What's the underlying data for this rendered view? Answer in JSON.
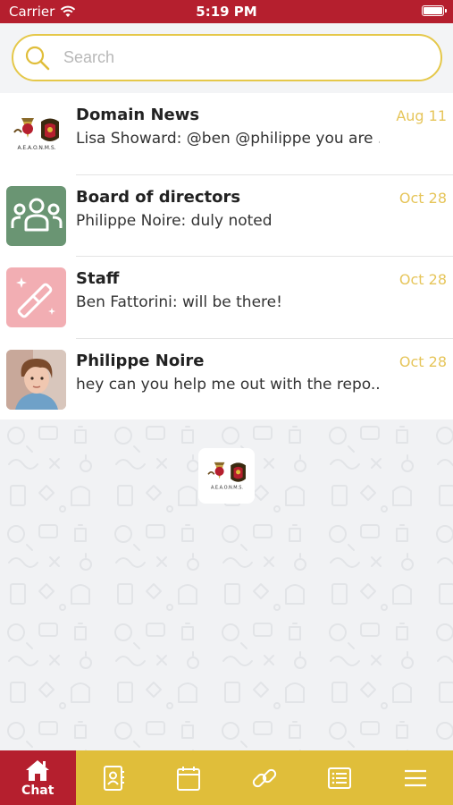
{
  "status_bar": {
    "carrier": "Carrier",
    "time": "5:19 PM"
  },
  "search": {
    "placeholder": "Search",
    "value": ""
  },
  "chats": [
    {
      "title": "Domain News",
      "preview": "Lisa Showard: @ben @philippe you are ...",
      "date": "Aug 11",
      "avatar": "organization-logo"
    },
    {
      "title": "Board of directors",
      "preview": "Philippe Noire: duly noted",
      "date": "Oct 28",
      "avatar": "group-icon",
      "avatar_color": "#6a9573"
    },
    {
      "title": "Staff",
      "preview": "Ben Fattorini: will be there!",
      "date": "Oct 28",
      "avatar": "magic-wand-icon",
      "avatar_color": "#f2aeb3"
    },
    {
      "title": "Philippe Noire",
      "preview": "hey can you help me out with the repo...",
      "date": "Oct 28",
      "avatar": "person-photo"
    }
  ],
  "logo": {
    "caption": "A.E.A.O.N.M.S."
  },
  "tab_bar": {
    "tabs": [
      {
        "label": "Chat",
        "icon": "home-icon",
        "active": true
      },
      {
        "icon": "contacts-icon"
      },
      {
        "icon": "calendar-icon"
      },
      {
        "icon": "link-icon"
      },
      {
        "icon": "list-icon"
      },
      {
        "icon": "menu-icon"
      }
    ]
  },
  "colors": {
    "header": "#b51f2e",
    "accent": "#e0be3a",
    "date": "#e6c55a",
    "board_avatar": "#6a9573",
    "staff_avatar": "#f2aeb3"
  }
}
